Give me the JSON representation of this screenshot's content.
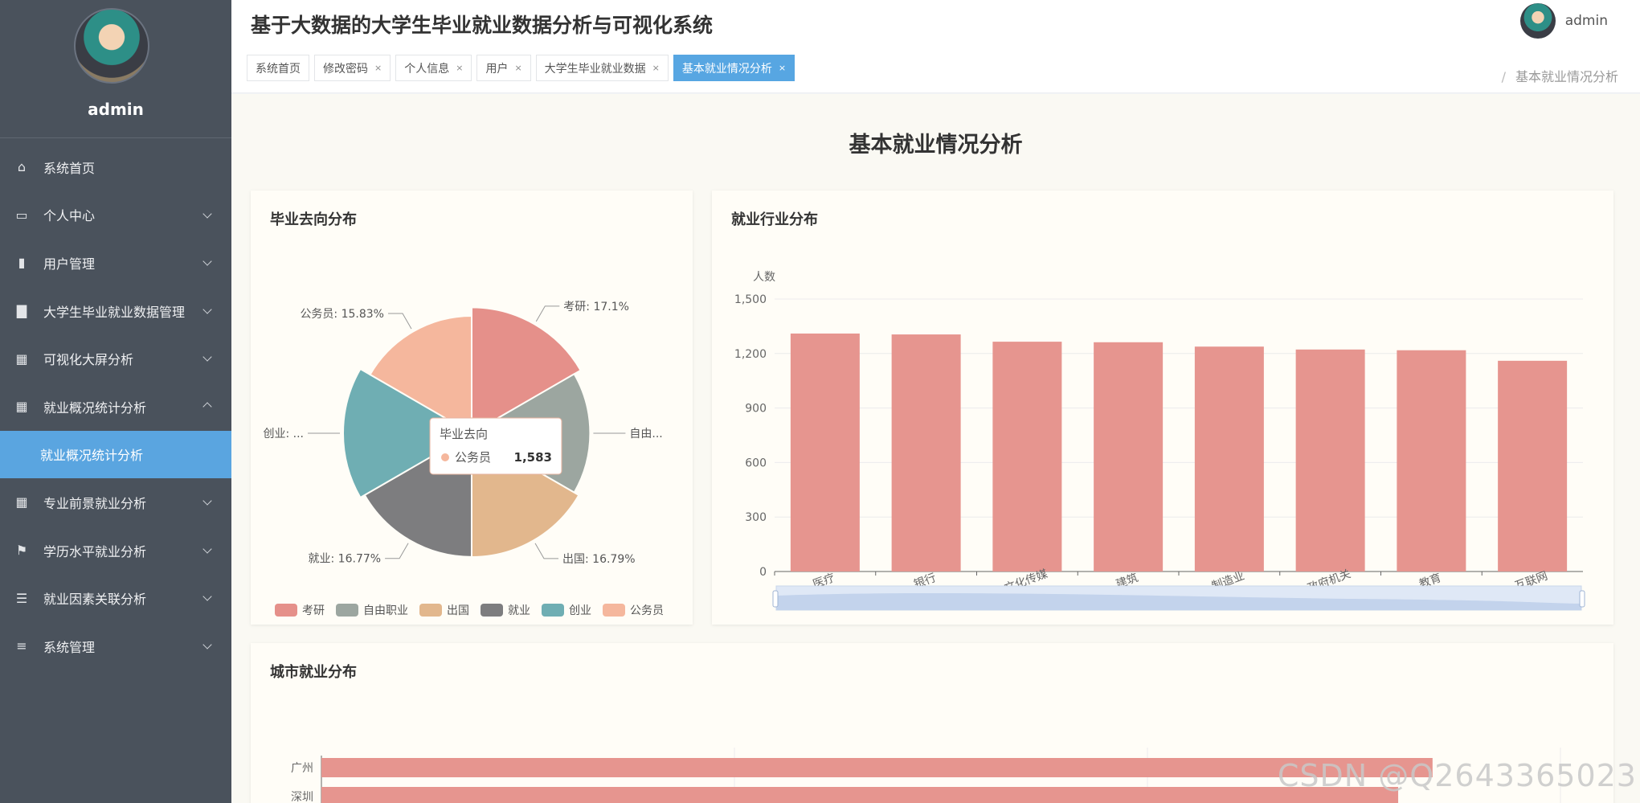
{
  "sidebar": {
    "username": "admin",
    "menu": [
      {
        "label": "系统首页",
        "icon": "home-icon",
        "expandable": false
      },
      {
        "label": "个人中心",
        "icon": "card-icon",
        "expandable": true
      },
      {
        "label": "用户管理",
        "icon": "books-icon",
        "expandable": true
      },
      {
        "label": "大学生毕业就业数据管理",
        "icon": "bar-chart-icon",
        "expandable": true
      },
      {
        "label": "可视化大屏分析",
        "icon": "grid-icon",
        "expandable": true
      },
      {
        "label": "就业概况统计分析",
        "icon": "grid-icon",
        "expandable": true,
        "expanded": true
      },
      {
        "label": "就业概况统计分析",
        "icon": "",
        "sub": true,
        "active": true
      },
      {
        "label": "专业前景就业分析",
        "icon": "grid-icon",
        "expandable": true
      },
      {
        "label": "学历水平就业分析",
        "icon": "flag-icon",
        "expandable": true
      },
      {
        "label": "就业因素关联分析",
        "icon": "sliders-icon",
        "expandable": true
      },
      {
        "label": "系统管理",
        "icon": "list-icon",
        "expandable": true
      }
    ]
  },
  "header": {
    "title": "基于大数据的大学生毕业就业数据分析与可视化系统",
    "user": "admin",
    "tabs": [
      {
        "label": "系统首页",
        "closable": false,
        "active": false
      },
      {
        "label": "修改密码",
        "closable": true,
        "active": false
      },
      {
        "label": "个人信息",
        "closable": true,
        "active": false
      },
      {
        "label": "用户",
        "closable": true,
        "active": false
      },
      {
        "label": "大学生毕业就业数据",
        "closable": true,
        "active": false
      },
      {
        "label": "基本就业情况分析",
        "closable": true,
        "active": true
      }
    ],
    "close_glyph": "×",
    "breadcrumb_sep": "/",
    "breadcrumb": "基本就业情况分析"
  },
  "page": {
    "title": "基本就业情况分析",
    "watermark": "CSDN @Q2643365023"
  },
  "colors": {
    "accent": "#57a6e2",
    "bar": "#e6958f",
    "sidebar": "#4a525c"
  },
  "chart_data": [
    {
      "type": "pie",
      "title": "毕业去向分布",
      "rose": true,
      "slices": [
        {
          "name": "考研",
          "percent": 17.1,
          "label": "考研: 17.1%",
          "color": "#e5908a"
        },
        {
          "name": "自由职业",
          "percent": 16.0,
          "label": "自由...",
          "color": "#9ca6a0"
        },
        {
          "name": "出国",
          "percent": 16.79,
          "label": "出国: 16.79%",
          "color": "#e2b78d"
        },
        {
          "name": "就业",
          "percent": 16.77,
          "label": "就业: 16.77%",
          "color": "#7d7d7f"
        },
        {
          "name": "创业",
          "percent": 17.51,
          "label": "创业: ...",
          "color": "#6faeb3"
        },
        {
          "name": "公务员",
          "percent": 15.83,
          "label": "公务员: 15.83%",
          "color": "#f5b79d"
        }
      ],
      "legend": [
        "考研",
        "自由职业",
        "出国",
        "就业",
        "创业",
        "公务员"
      ],
      "legend_position": "bottom",
      "tooltip": {
        "title": "毕业去向",
        "name": "公务员",
        "value": "1,583"
      }
    },
    {
      "type": "bar",
      "title": "就业行业分布",
      "ylabel": "人数",
      "ylim": [
        0,
        1500
      ],
      "yticks": [
        "0",
        "300",
        "600",
        "900",
        "1,200",
        "1,500"
      ],
      "categories": [
        "医疗",
        "银行",
        "文化传媒",
        "建筑",
        "制造业",
        "政府机关",
        "教育",
        "互联网"
      ],
      "values": [
        1310,
        1305,
        1265,
        1262,
        1238,
        1222,
        1218,
        1160
      ],
      "color": "#e6958f",
      "datazoom": true
    },
    {
      "type": "bar",
      "orientation": "horizontal",
      "title": "城市就业分布",
      "categories": [
        "广州",
        "深圳"
      ],
      "values": [
        1390,
        1347
      ],
      "color": "#e6958f"
    }
  ]
}
